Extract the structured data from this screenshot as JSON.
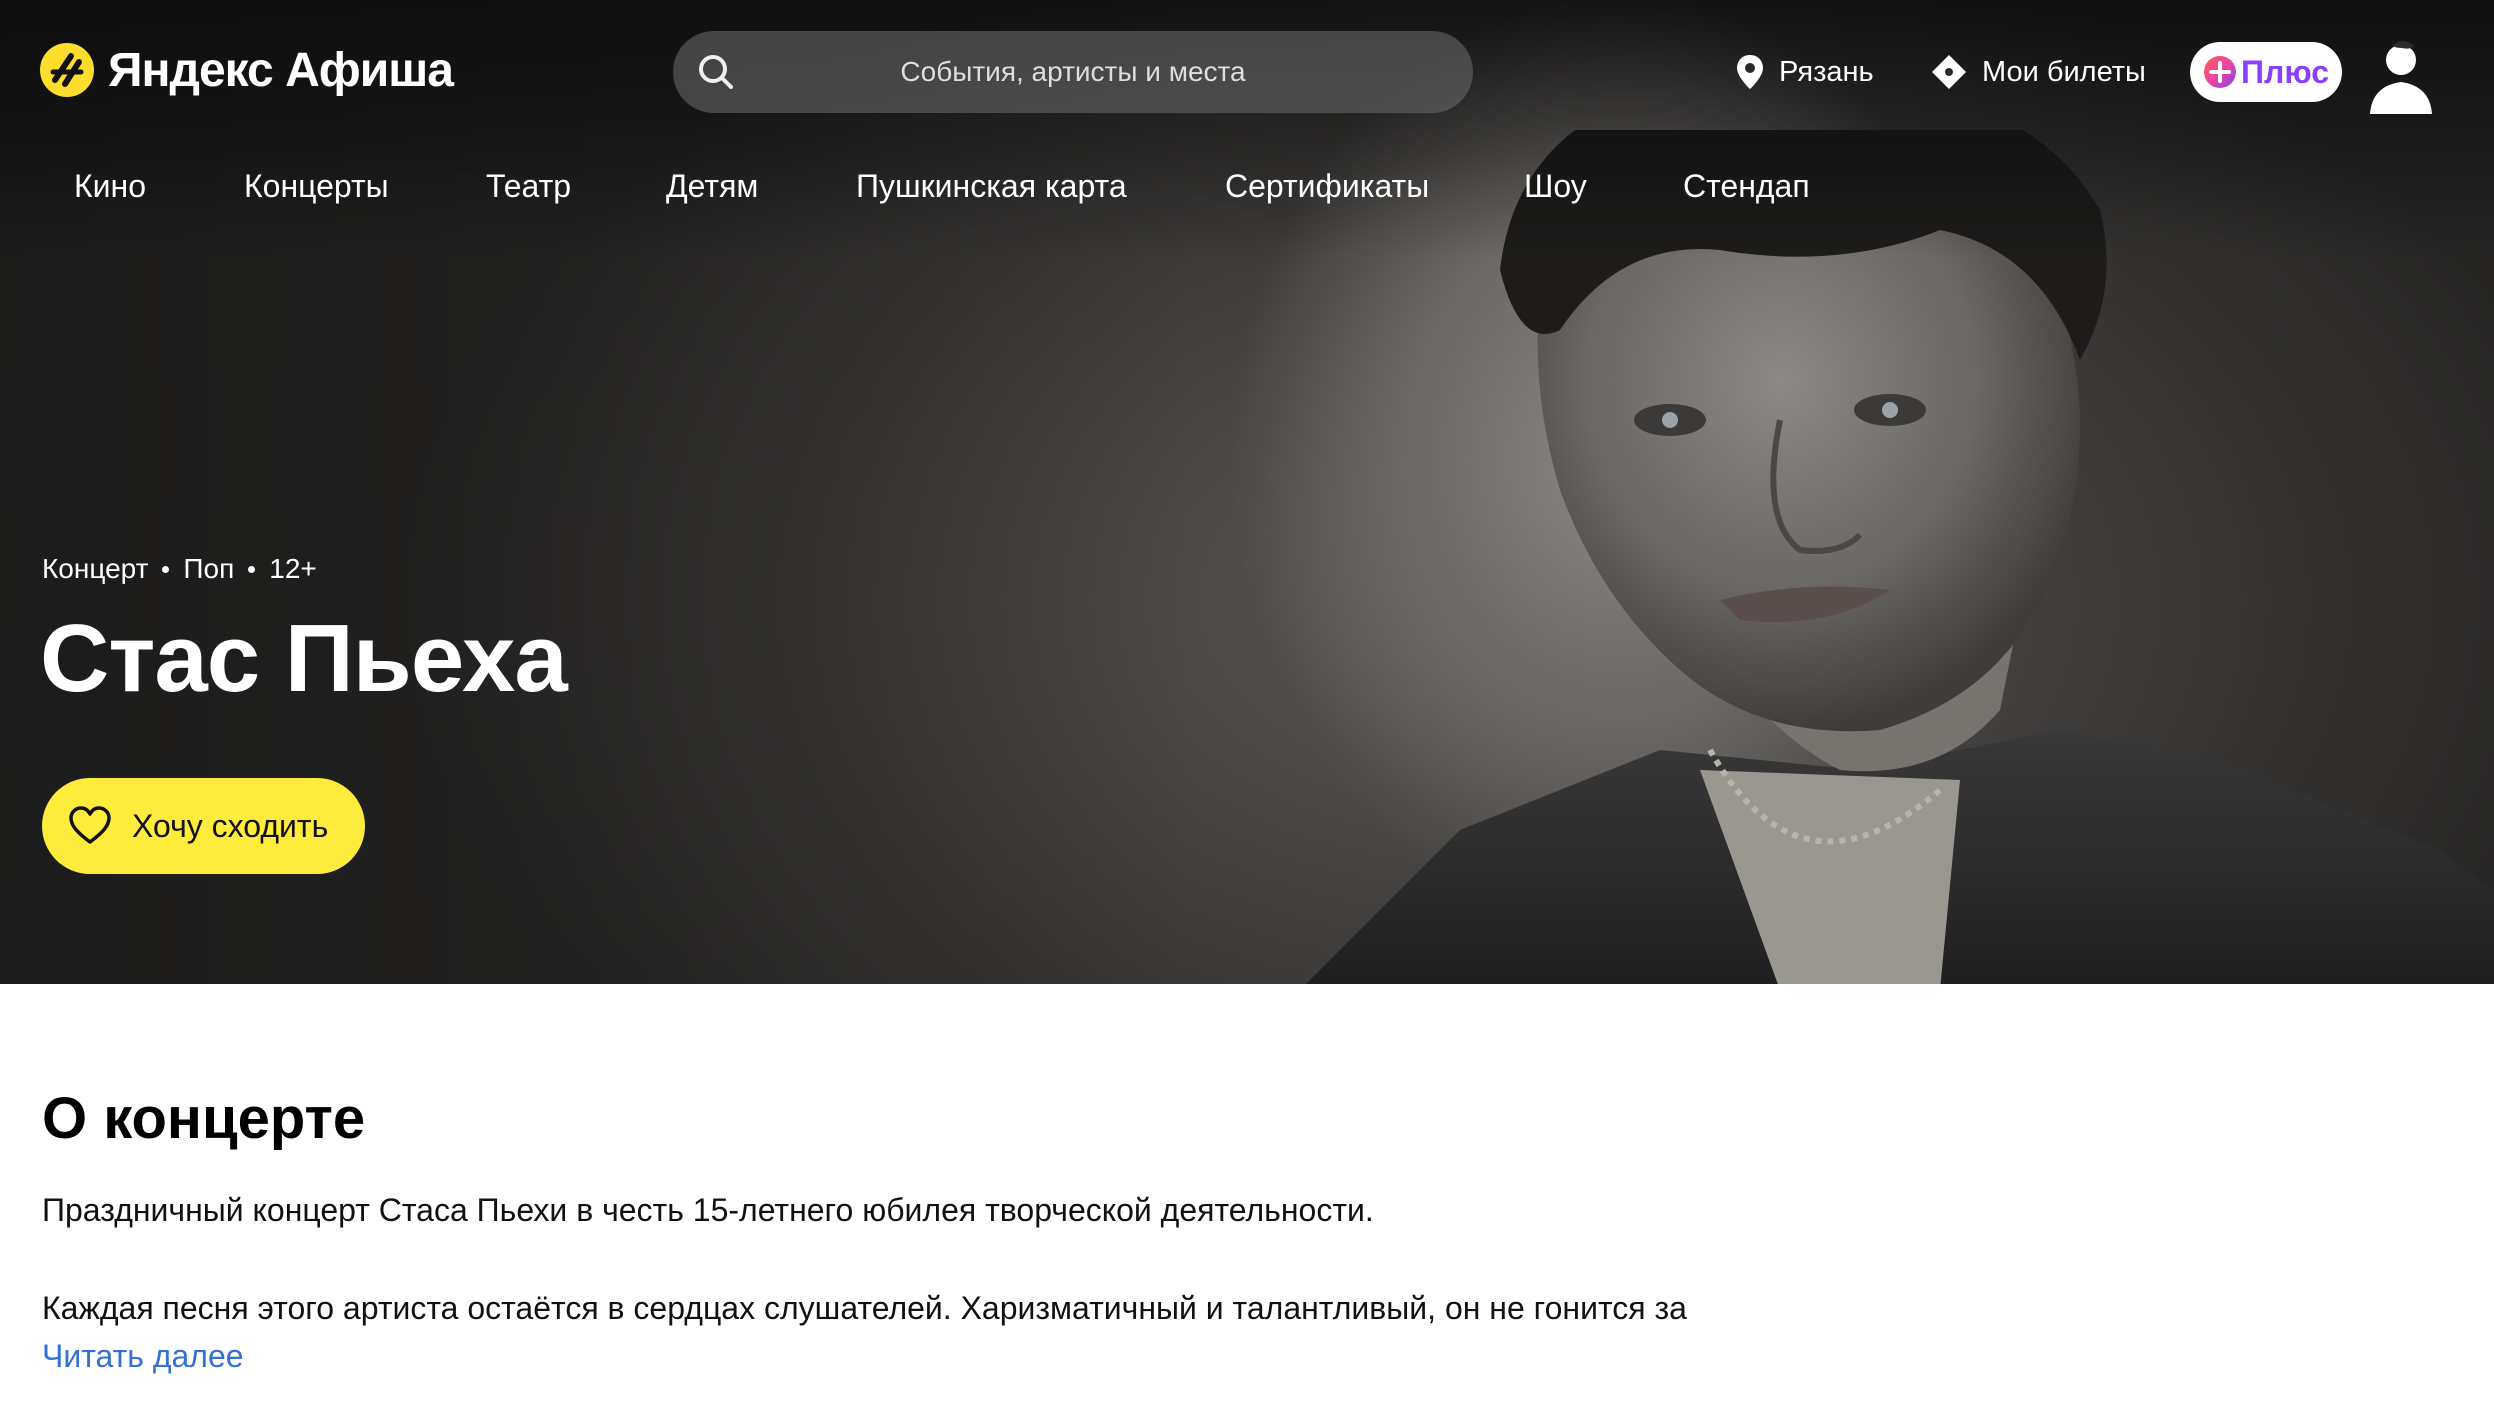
{
  "header": {
    "logo_text": "Яндекс Афиша",
    "search_placeholder": "События, артисты и места",
    "city": "Рязань",
    "tickets_label": "Мои билеты",
    "plus_label": "Плюс"
  },
  "nav": {
    "items": [
      {
        "label": "Кино"
      },
      {
        "label": "Концерты"
      },
      {
        "label": "Театр"
      },
      {
        "label": "Детям"
      },
      {
        "label": "Пушкинская карта"
      },
      {
        "label": "Сертификаты"
      },
      {
        "label": "Шоу"
      },
      {
        "label": "Стендап"
      }
    ]
  },
  "event": {
    "meta": [
      "Концерт",
      "Поп",
      "12+"
    ],
    "title": "Стас Пьеха",
    "want_button": "Хочу сходить"
  },
  "about": {
    "title": "О концерте",
    "paragraph1": "Праздничный концерт Стаса Пьехи в честь 15-летнего юбилея творческой деятельности.",
    "paragraph2": "Каждая песня этого артиста остаётся в сердцах слушателей. Харизматичный и талантливый, он не гонится за",
    "read_more": "Читать далее"
  },
  "colors": {
    "accent_yellow": "#ffeb3b",
    "logo_yellow": "#ffdd2d",
    "link_blue": "#3371d4",
    "plus_purple": "#8a3ffc"
  },
  "icons": {
    "search": "search-icon",
    "location": "location-pin-icon",
    "ticket": "ticket-icon",
    "heart": "heart-icon",
    "avatar": "user-avatar-icon",
    "plus": "plus-logo-icon"
  }
}
